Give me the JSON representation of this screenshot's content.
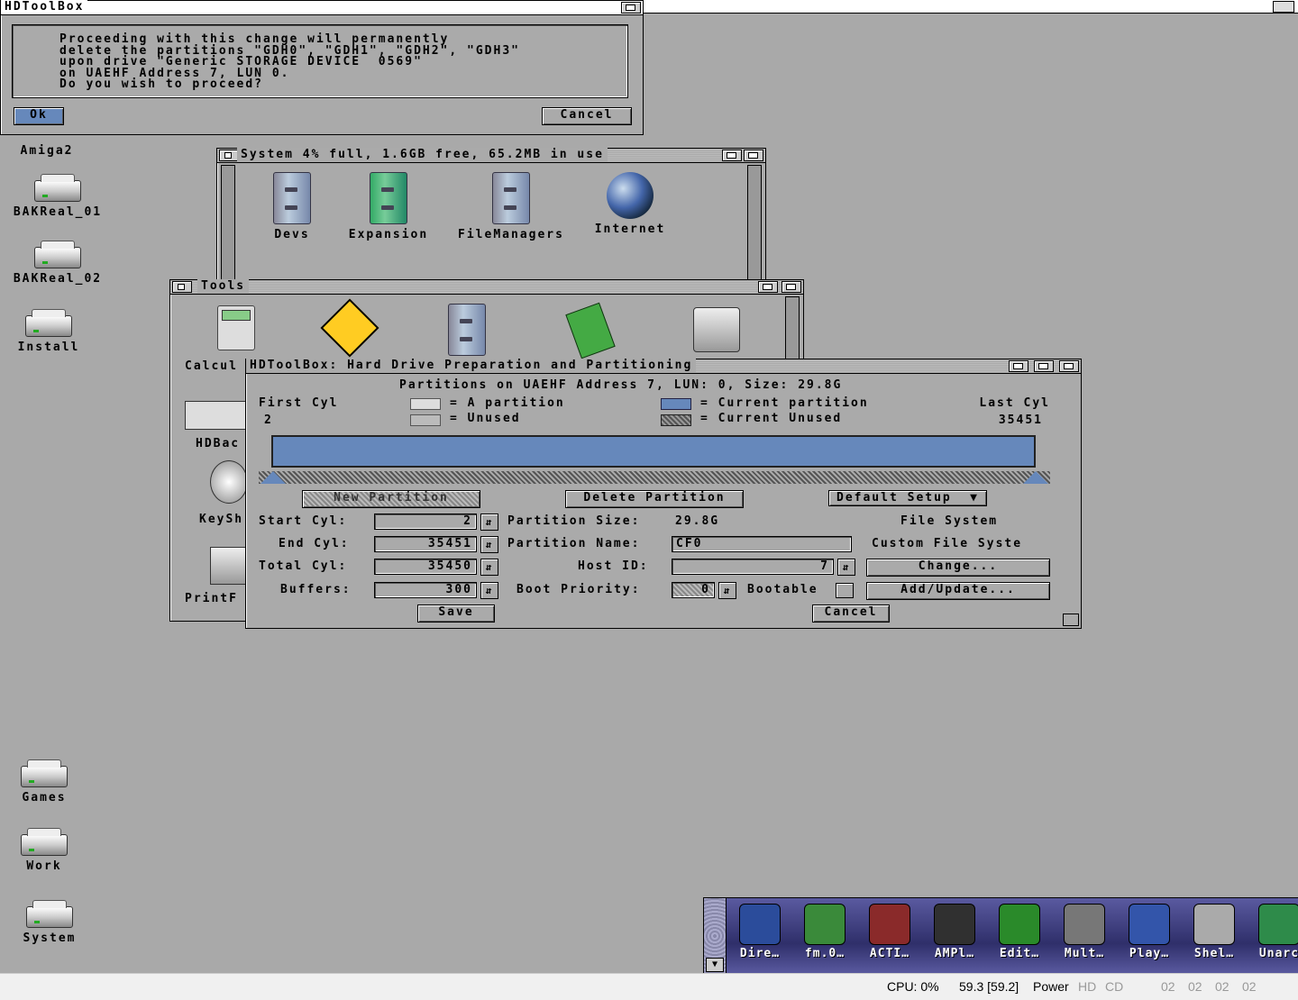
{
  "screen": {
    "title": ""
  },
  "requester": {
    "title": "HDToolBox",
    "message": [
      "Proceeding with this change will permanently",
      "delete the partitions \"GDH0\", \"GDH1\", \"GDH2\", \"GDH3\"",
      "upon drive \"Generic STORAGE DEVICE  0569\"",
      "on UAEHF Address 7, LUN 0.",
      "Do you wish to proceed?"
    ],
    "ok_label": "Ok",
    "cancel_label": "Cancel"
  },
  "desktop_icons": [
    {
      "label": "Amiga2"
    },
    {
      "label": "BAKReal_01"
    },
    {
      "label": "BAKReal_02"
    },
    {
      "label": "Install"
    },
    {
      "label": "Games"
    },
    {
      "label": "Work"
    },
    {
      "label": "System"
    }
  ],
  "system_window": {
    "title": "System  4% full, 1.6GB free, 65.2MB in use",
    "icons": [
      {
        "label": "Devs"
      },
      {
        "label": "Expansion"
      },
      {
        "label": "FileManagers"
      },
      {
        "label": "Internet"
      }
    ]
  },
  "tools_window": {
    "title": "Tools",
    "partial_labels": [
      "Calcul",
      "HDBac",
      "KeySh",
      "PrintF"
    ]
  },
  "hdtoolbox": {
    "title": "HDToolBox: Hard Drive Preparation and Partitioning",
    "header": "Partitions on UAEHF Address 7, LUN: 0, Size: 29.8G",
    "first_cyl_label": "First Cyl",
    "first_cyl_value": "2",
    "last_cyl_label": "Last Cyl",
    "last_cyl_value": "35451",
    "legend": {
      "a_partition": "= A partition",
      "unused": "= Unused",
      "current_partition": "= Current partition",
      "current_unused": "= Current Unused"
    },
    "new_partition_label": "New Partition",
    "delete_partition_label": "Delete Partition",
    "default_setup_label": "Default Setup",
    "start_cyl_label": "Start Cyl:",
    "start_cyl_value": "2",
    "end_cyl_label": "End Cyl:",
    "end_cyl_value": "35451",
    "total_cyl_label": "Total Cyl:",
    "total_cyl_value": "35450",
    "buffers_label": "Buffers:",
    "buffers_value": "300",
    "partition_size_label": "Partition Size:",
    "partition_size_value": "29.8G",
    "partition_name_label": "Partition Name:",
    "partition_name_value": "CF0",
    "host_id_label": "Host ID:",
    "host_id_value": "7",
    "boot_priority_label": "Boot Priority:",
    "boot_priority_value": "0",
    "bootable_label": "Bootable",
    "file_system_label": "File System",
    "file_system_value": "Custom File Syste",
    "change_label": "Change...",
    "add_update_label": "Add/Update...",
    "save_label": "Save",
    "cancel_label": "Cancel"
  },
  "dock": {
    "items": [
      {
        "label": "Dire…",
        "color": "#2b4c9b"
      },
      {
        "label": "fm.0…",
        "color": "#3a8a3a"
      },
      {
        "label": "ACTI…",
        "color": "#8a2a2a"
      },
      {
        "label": "AMPl…",
        "color": "#303030"
      },
      {
        "label": "Edit…",
        "color": "#2a8a2a"
      },
      {
        "label": "Mult…",
        "color": "#777777"
      },
      {
        "label": "Play…",
        "color": "#3355aa"
      },
      {
        "label": "Shel…",
        "color": "#aaaaaa"
      },
      {
        "label": "Unarc",
        "color": "#2e8b4a"
      }
    ]
  },
  "statusbar": {
    "cpu": "CPU: 0%",
    "fps": "59.3 [59.2]",
    "power": "Power",
    "hd": "HD",
    "cd": "CD",
    "drives": [
      "02",
      "02",
      "02",
      "02"
    ]
  },
  "colors": {
    "desktop": "#a9a9a9",
    "partition_blue": "#6688bb",
    "window_gray": "#aaaaaa"
  }
}
